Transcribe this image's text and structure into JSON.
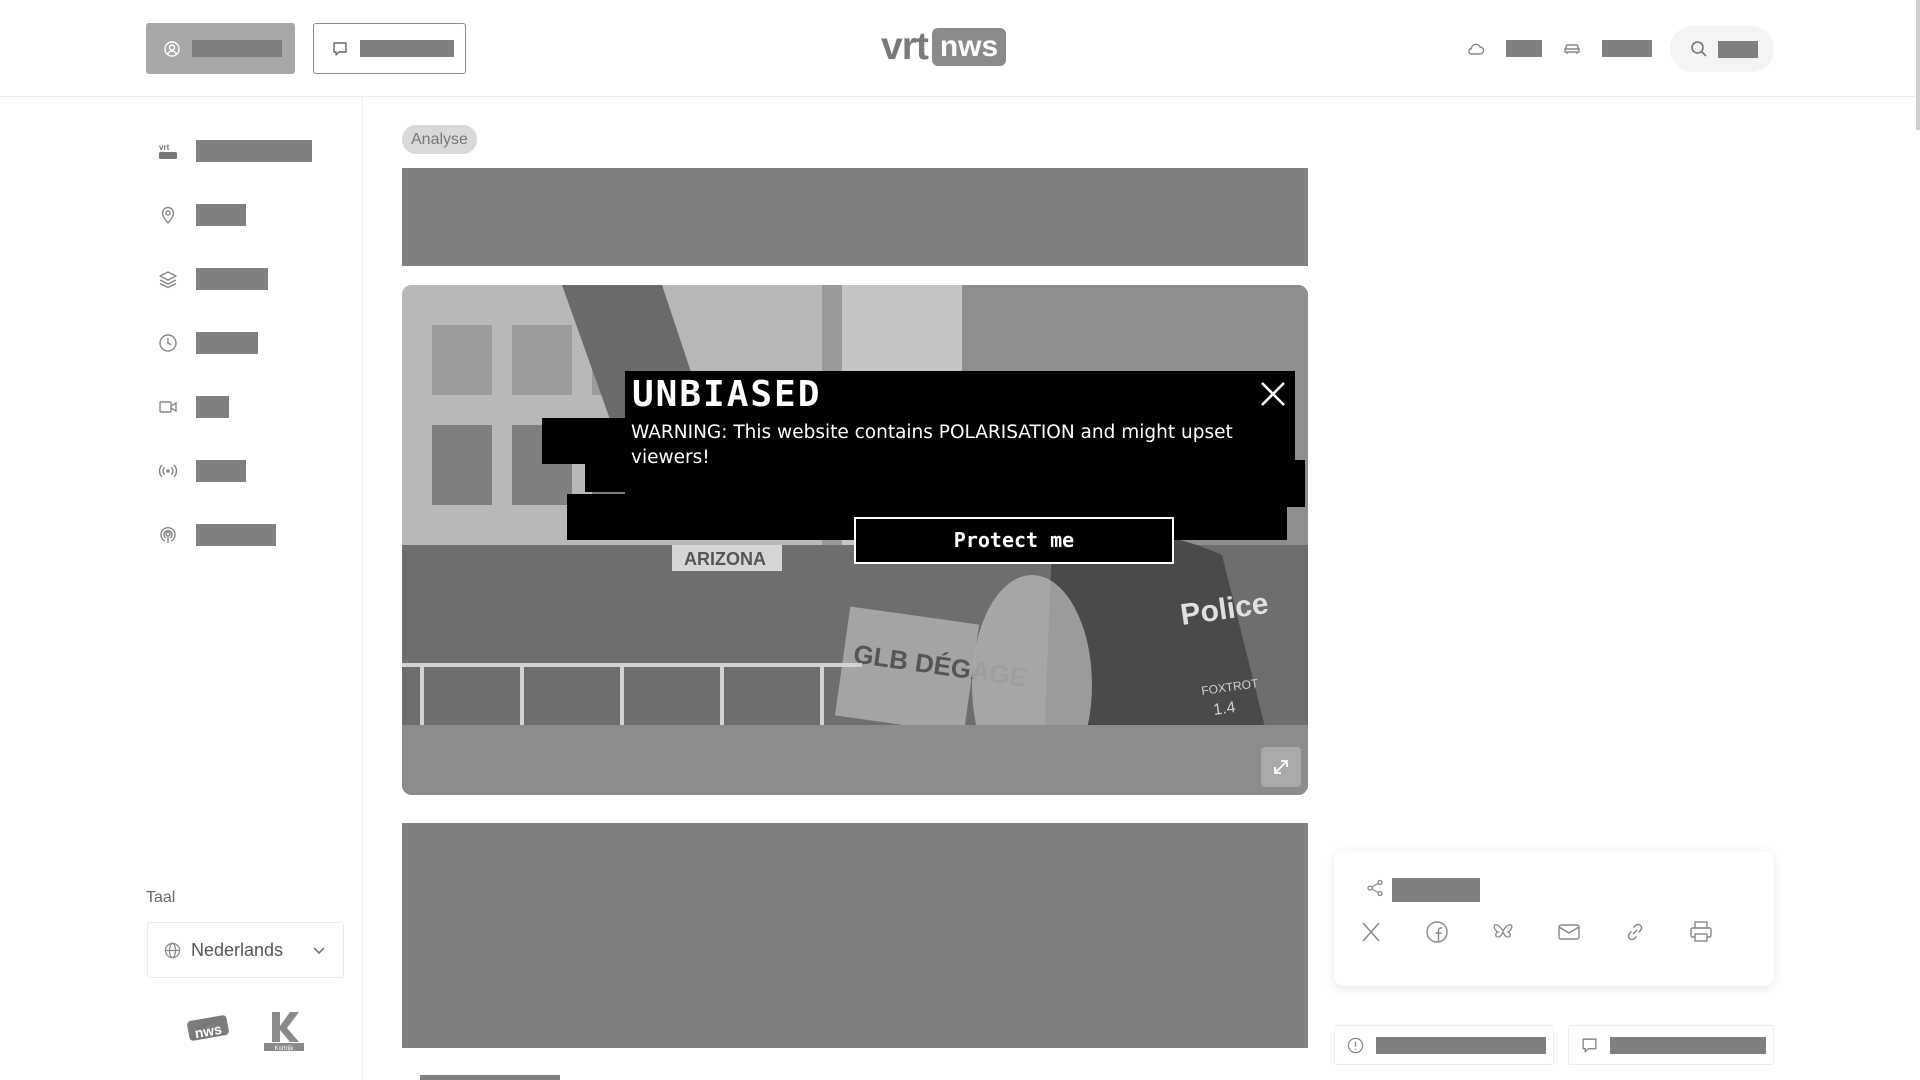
{
  "header": {
    "logo_left": "vrt",
    "logo_right": "nws"
  },
  "sidebar": {
    "language_heading": "Taal",
    "language_selected": "Nederlands"
  },
  "article": {
    "tag": "Analyse",
    "hero_photo_words": {
      "police": "Police",
      "sign": "ARIZONA",
      "banner": "GLB DÉGAGE",
      "foxtrot": "FOXTROT",
      "number": "1.4"
    }
  },
  "popup": {
    "title": "UNBIASED",
    "warning": "WARNING: This website contains POLARISATION and might upset viewers!",
    "button": "Protect me"
  },
  "footer_logos": {
    "nws": "nws",
    "kortrijk": "Kortrijk"
  }
}
